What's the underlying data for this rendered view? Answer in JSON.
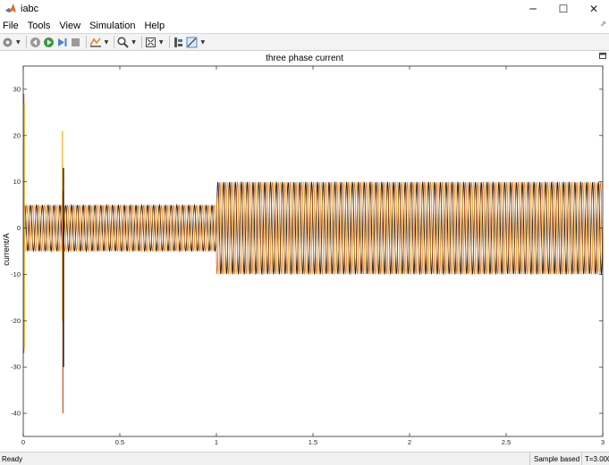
{
  "window": {
    "title": "iabc",
    "minimize_glyph": "─",
    "maximize_glyph": "☐",
    "close_glyph": "✕",
    "pin_glyph": "⬀"
  },
  "menu": [
    "File",
    "Tools",
    "View",
    "Simulation",
    "Help"
  ],
  "toolbar": {
    "buttons": [
      "settings-icon",
      "step-back-icon",
      "run-icon",
      "step-forward-icon",
      "stop-icon",
      "highlight-icon",
      "zoom-icon",
      "fit-view-icon",
      "cursor-measure-icon",
      "trigger-icon"
    ]
  },
  "chart_data": {
    "type": "line",
    "title": "three phase current",
    "xlabel": "",
    "ylabel": "current/A",
    "xlim": [
      0,
      3
    ],
    "ylim": [
      -45,
      35
    ],
    "x_ticks": [
      "0",
      "0.5",
      "1",
      "1.5",
      "2",
      "2.5",
      "3"
    ],
    "y_ticks": [
      "30",
      "20",
      "10",
      "0",
      "-10",
      "-20",
      "-30",
      "-40"
    ],
    "grid": false,
    "series": [
      {
        "color": "#000000",
        "amplitude_segments": [
          {
            "x": [
              0,
              0.2
            ],
            "amp": 5
          },
          {
            "x": [
              0.2,
              1.0
            ],
            "amp": 5
          },
          {
            "x": [
              1.0,
              3.0
            ],
            "amp": 10
          }
        ],
        "frequency_hz": 50,
        "phase_deg": 0
      },
      {
        "color": "#d95319",
        "amplitude_segments": [
          {
            "x": [
              0,
              0.2
            ],
            "amp": 5
          },
          {
            "x": [
              0.2,
              1.0
            ],
            "amp": 5
          },
          {
            "x": [
              1.0,
              3.0
            ],
            "amp": 10
          }
        ],
        "frequency_hz": 50,
        "phase_deg": -120
      },
      {
        "color": "#edb120",
        "amplitude_segments": [
          {
            "x": [
              0,
              0.2
            ],
            "amp": 5
          },
          {
            "x": [
              0.2,
              1.0
            ],
            "amp": 5
          },
          {
            "x": [
              1.0,
              3.0
            ],
            "amp": 10
          }
        ],
        "frequency_hz": 50,
        "phase_deg": 120
      }
    ],
    "transients": [
      {
        "x": 0.0,
        "peaks": [
          {
            "color": "#d95319",
            "max": 29,
            "min": -27
          },
          {
            "color": "#edb120",
            "max": 27,
            "min": -26
          }
        ]
      },
      {
        "x": 0.2,
        "peaks": [
          {
            "color": "#edb120",
            "max": 21,
            "min": -20
          },
          {
            "color": "#d95319",
            "max": 8,
            "min": -40
          },
          {
            "color": "#000000",
            "max": 13,
            "min": -30
          }
        ]
      }
    ]
  },
  "status": {
    "left": "Ready",
    "mode": "Sample based",
    "time": "T=3.000"
  }
}
